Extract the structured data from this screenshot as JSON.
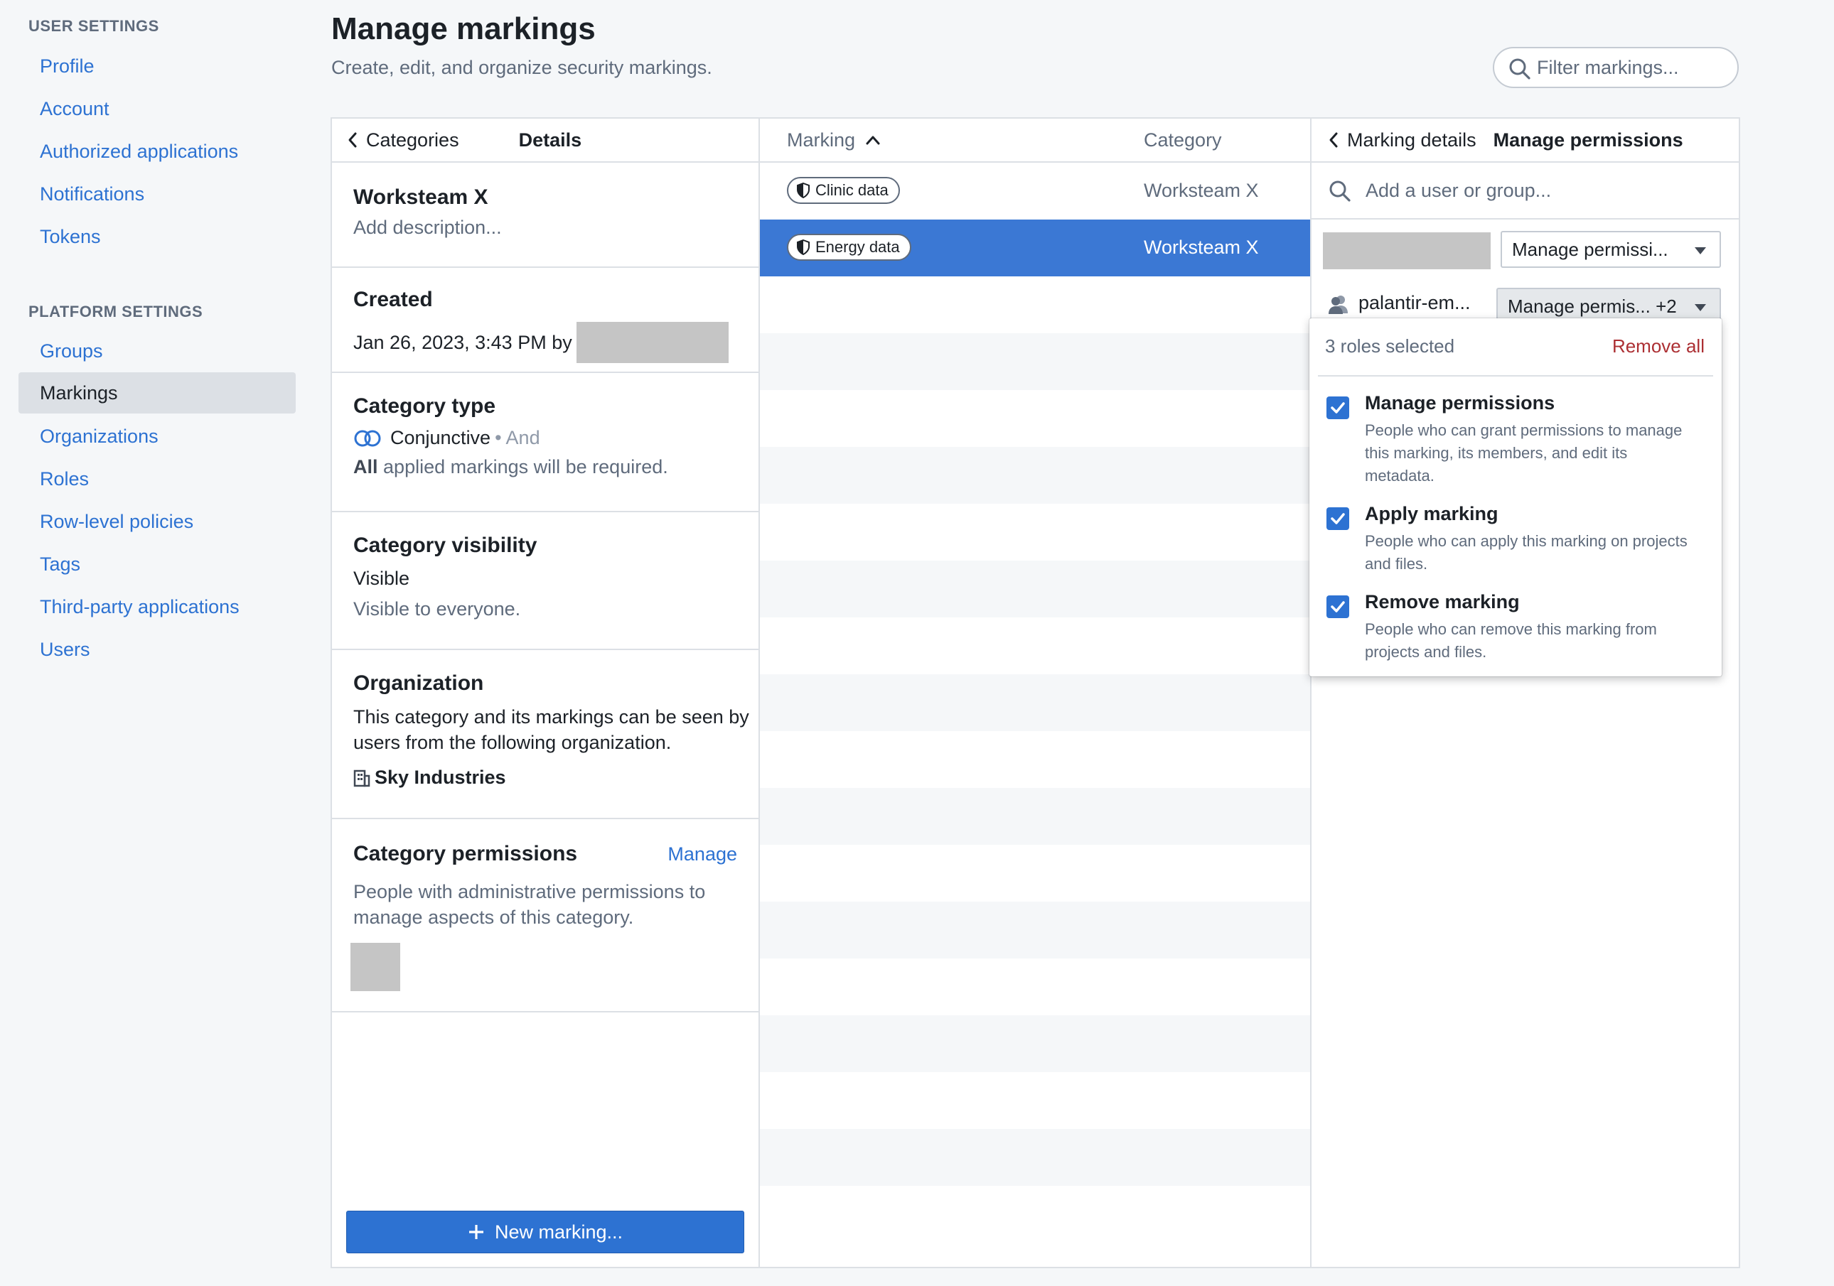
{
  "sidebar": {
    "user_settings_title": "USER SETTINGS",
    "user_items": [
      "Profile",
      "Account",
      "Authorized applications",
      "Notifications",
      "Tokens"
    ],
    "platform_settings_title": "PLATFORM SETTINGS",
    "platform_items": [
      "Groups",
      "Markings",
      "Organizations",
      "Roles",
      "Row-level policies",
      "Tags",
      "Third-party applications",
      "Users"
    ],
    "active_item": "Markings"
  },
  "header": {
    "title": "Manage markings",
    "subtitle": "Create, edit, and organize security markings.",
    "filter_placeholder": "Filter markings..."
  },
  "details_panel": {
    "back_label": "Categories",
    "header_label": "Details",
    "category_name": "Worksteam X",
    "description_placeholder": "Add description...",
    "created_title": "Created",
    "created_text": "Jan 26, 2023, 3:43 PM by",
    "type_title": "Category type",
    "type_value": "Conjunctive",
    "type_suffix": "• And",
    "type_desc_bold": "All",
    "type_desc": "applied markings will be required.",
    "visibility_title": "Category visibility",
    "visibility_value": "Visible",
    "visibility_desc": "Visible to everyone.",
    "org_title": "Organization",
    "org_desc_line1": "This category and its markings can be seen by",
    "org_desc_line2": "users from the following organization.",
    "org_name": "Sky Industries",
    "perm_title": "Category permissions",
    "perm_manage": "Manage",
    "perm_desc_line1": "People with administrative permissions to",
    "perm_desc_line2": "manage aspects of this category.",
    "new_marking_label": "New marking..."
  },
  "markings_table": {
    "col_marking": "Marking",
    "col_category": "Category",
    "rows": [
      {
        "marking": "Clinic data",
        "category": "Worksteam X",
        "selected": false
      },
      {
        "marking": "Energy data",
        "category": "Worksteam X",
        "selected": true
      }
    ]
  },
  "permissions_panel": {
    "back_label": "Marking details",
    "header_label": "Manage permissions",
    "search_placeholder": "Add a user or group...",
    "entries": [
      {
        "name": "",
        "role_select": "Manage permissi..."
      },
      {
        "name": "palantir-em...",
        "role_select": "Manage permis... +2"
      }
    ]
  },
  "roles_popover": {
    "count_label": "3 roles selected",
    "remove_all": "Remove all",
    "roles": [
      {
        "title": "Manage permissions",
        "desc_lines": [
          "People who can grant permissions to manage",
          "this marking, its members, and edit its",
          "metadata."
        ],
        "checked": true
      },
      {
        "title": "Apply marking",
        "desc_lines": [
          "People who can apply this marking on projects",
          "and files."
        ],
        "checked": true
      },
      {
        "title": "Remove marking",
        "desc_lines": [
          "People who can remove this marking from",
          "projects and files."
        ],
        "checked": true
      }
    ]
  },
  "colors": {
    "accent": "#2d72d2",
    "selected_row": "#3b78d4",
    "danger": "#ac2f33",
    "muted_text": "#5f6b7c"
  }
}
